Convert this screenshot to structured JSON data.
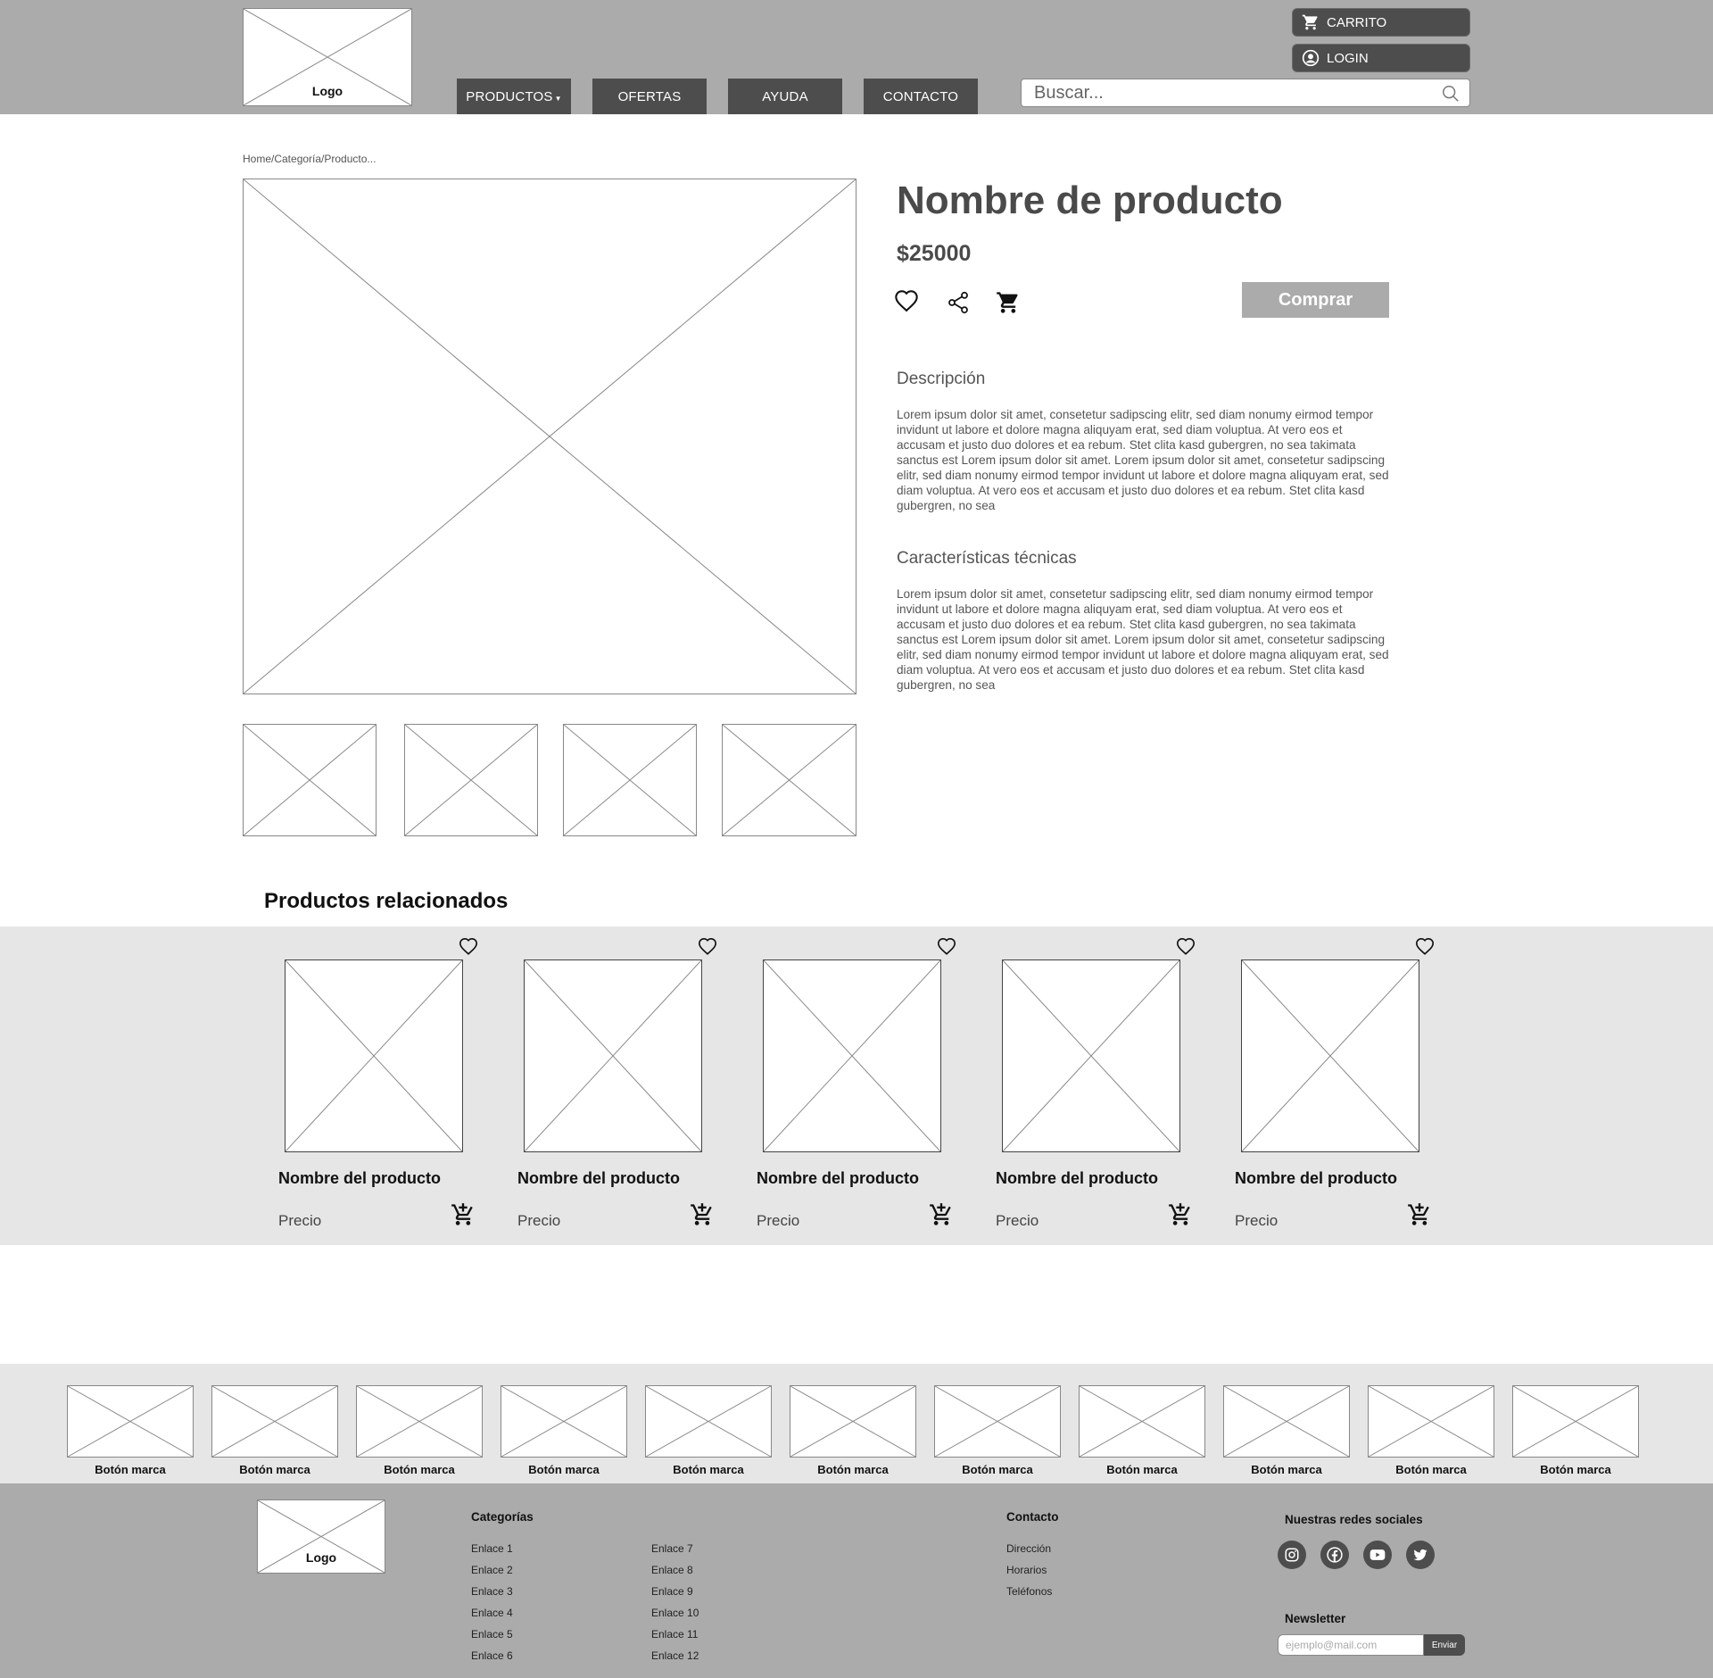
{
  "header": {
    "logo_label": "Logo",
    "nav": [
      "PRODUCTOS",
      "OFERTAS",
      "AYUDA",
      "CONTACTO"
    ],
    "cart_label": "CARRITO",
    "login_label": "LOGIN",
    "search_placeholder": "Buscar..."
  },
  "breadcrumb": "Home/Categoría/Producto...",
  "product": {
    "title": "Nombre de producto",
    "price": "$25000",
    "buy_label": "Comprar",
    "description_title": "Descripción",
    "description_text": "Lorem ipsum dolor sit amet, consetetur sadipscing elitr, sed diam nonumy eirmod tempor invidunt ut labore et dolore magna aliquyam erat, sed diam voluptua. At vero eos et accusam et justo duo dolores et ea rebum. Stet clita kasd gubergren, no sea takimata sanctus est Lorem ipsum dolor sit amet. Lorem ipsum dolor sit amet, consetetur sadipscing elitr, sed diam nonumy eirmod tempor invidunt ut labore et dolore magna aliquyam erat, sed diam voluptua. At vero eos et accusam et justo duo dolores et ea rebum. Stet clita kasd gubergren, no sea",
    "tech_title": "Características técnicas",
    "tech_text": "Lorem ipsum dolor sit amet, consetetur sadipscing elitr, sed diam nonumy eirmod tempor invidunt ut labore et dolore magna aliquyam erat, sed diam voluptua. At vero eos et accusam et justo duo dolores et ea rebum. Stet clita kasd gubergren, no sea takimata sanctus est Lorem ipsum dolor sit amet. Lorem ipsum dolor sit amet, consetetur sadipscing elitr, sed diam nonumy eirmod tempor invidunt ut labore et dolore magna aliquyam erat, sed diam voluptua. At vero eos et accusam et justo duo dolores et ea rebum. Stet clita kasd gubergren, no sea"
  },
  "related": {
    "title": "Productos relacionados",
    "items": [
      {
        "name": "Nombre del producto",
        "price": "Precio"
      },
      {
        "name": "Nombre del producto",
        "price": "Precio"
      },
      {
        "name": "Nombre del producto",
        "price": "Precio"
      },
      {
        "name": "Nombre del producto",
        "price": "Precio"
      },
      {
        "name": "Nombre del producto",
        "price": "Precio"
      }
    ]
  },
  "brands": [
    "Botón marca",
    "Botón marca",
    "Botón marca",
    "Botón marca",
    "Botón marca",
    "Botón marca",
    "Botón marca",
    "Botón marca",
    "Botón marca",
    "Botón marca",
    "Botón marca"
  ],
  "footer": {
    "logo_label": "Logo",
    "categories_title": "Categorías",
    "links_col1": [
      "Enlace 1",
      "Enlace 2",
      "Enlace 3",
      "Enlace 4",
      "Enlace 5",
      "Enlace 6"
    ],
    "links_col2": [
      "Enlace 7",
      "Enlace 8",
      "Enlace 9",
      "Enlace 10",
      "Enlace 11",
      "Enlace 12"
    ],
    "contact_title": "Contacto",
    "contact_links": [
      "Dirección",
      "Horarios",
      "Teléfonos"
    ],
    "social_title": "Nuestras redes sociales",
    "social_icons": [
      "instagram-icon",
      "facebook-icon",
      "youtube-icon",
      "twitter-icon"
    ],
    "newsletter_title": "Newsletter",
    "newsletter_placeholder": "ejemplo@mail.com",
    "newsletter_send": "Enviar"
  },
  "colors": {
    "header_bg": "#ababab",
    "dark_button": "#4d4d4d",
    "band_bg": "#e6e6e6",
    "buy_button": "#ababab"
  }
}
